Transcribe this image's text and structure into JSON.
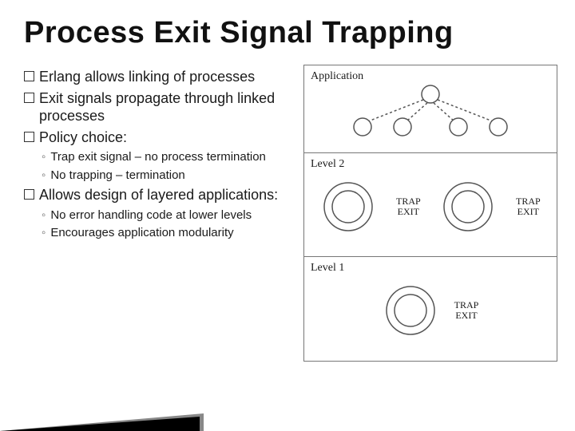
{
  "title": "Process Exit Signal Trapping",
  "bullets": {
    "b1": "Erlang allows linking of processes",
    "b2": "Exit signals propagate through linked processes",
    "b3": "Policy choice:",
    "b3a": "Trap exit signal – no process termination",
    "b3b": "No trapping – termination",
    "b4": "Allows design of layered applications:",
    "b4a": "No error handling code at lower levels",
    "b4b": "Encourages application modularity"
  },
  "diagram": {
    "panel1": "Application",
    "panel2": "Level 2",
    "panel3": "Level 1",
    "trap1": "TRAP",
    "trap2": "EXIT"
  }
}
